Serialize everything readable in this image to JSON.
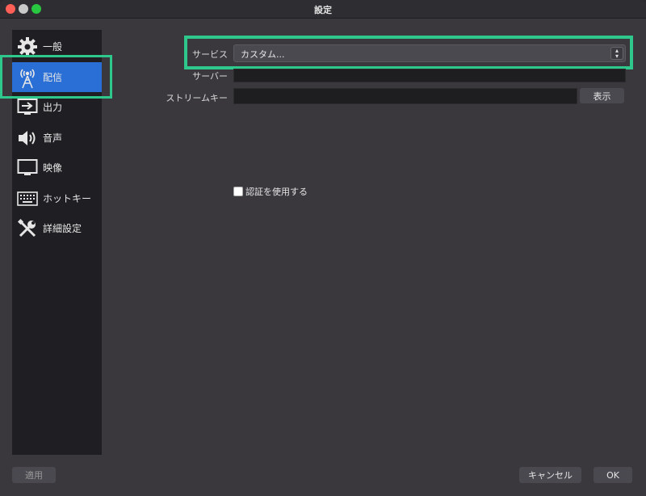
{
  "window": {
    "title": "設定"
  },
  "sidebar": {
    "items": [
      {
        "label": "一般",
        "icon": "gear-icon"
      },
      {
        "label": "配信",
        "icon": "broadcast-antenna-icon",
        "active": true
      },
      {
        "label": "出力",
        "icon": "output-monitor-icon"
      },
      {
        "label": "音声",
        "icon": "speaker-icon"
      },
      {
        "label": "映像",
        "icon": "display-icon"
      },
      {
        "label": "ホットキー",
        "icon": "keyboard-icon"
      },
      {
        "label": "詳細設定",
        "icon": "tools-icon"
      }
    ]
  },
  "stream": {
    "service_label": "サービス",
    "service_value": "カスタム...",
    "server_label": "サーバー",
    "server_value": "",
    "stream_key_label": "ストリームキー",
    "stream_key_value": "",
    "show_button": "表示",
    "auth_checkbox_label": "認証を使用する",
    "auth_checked": false
  },
  "footer": {
    "apply_button": "適用",
    "cancel_button": "キャンセル",
    "ok_button": "OK"
  },
  "colors": {
    "highlight": "#2ec78c",
    "active_item": "#2a6fd6",
    "background": "#3a383d",
    "sidebar": "#1f1e22"
  }
}
